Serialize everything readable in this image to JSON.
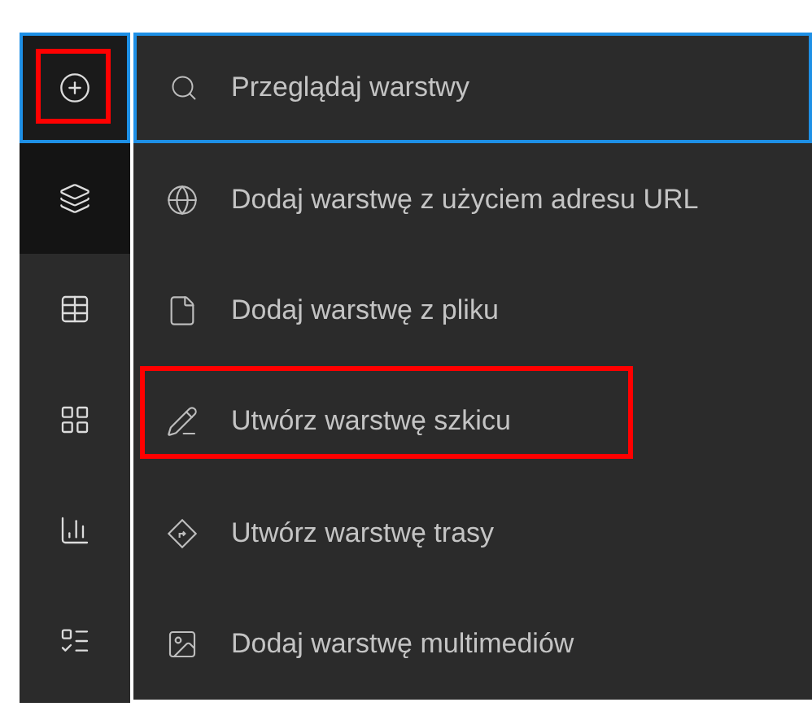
{
  "sidebar": {
    "items": [
      {
        "selected": true,
        "active": false,
        "highlighted": true
      },
      {
        "selected": false,
        "active": true,
        "highlighted": false
      },
      {
        "selected": false,
        "active": false,
        "highlighted": false
      },
      {
        "selected": false,
        "active": false,
        "highlighted": false
      },
      {
        "selected": false,
        "active": false,
        "highlighted": false
      },
      {
        "selected": false,
        "active": false,
        "highlighted": false
      }
    ]
  },
  "menu": {
    "items": [
      {
        "kind": "search",
        "label": "Przeglądaj warstwy",
        "selected": true,
        "highlighted": false
      },
      {
        "kind": "item",
        "label": "Dodaj warstwę z użyciem adresu URL",
        "selected": false,
        "highlighted": false
      },
      {
        "kind": "item",
        "label": "Dodaj warstwę z pliku",
        "selected": false,
        "highlighted": false
      },
      {
        "kind": "item",
        "label": "Utwórz warstwę szkicu",
        "selected": false,
        "highlighted": true
      },
      {
        "kind": "item",
        "label": "Utwórz warstwę trasy",
        "selected": false,
        "highlighted": false
      },
      {
        "kind": "item",
        "label": "Dodaj warstwę multimediów",
        "selected": false,
        "highlighted": false
      }
    ]
  }
}
